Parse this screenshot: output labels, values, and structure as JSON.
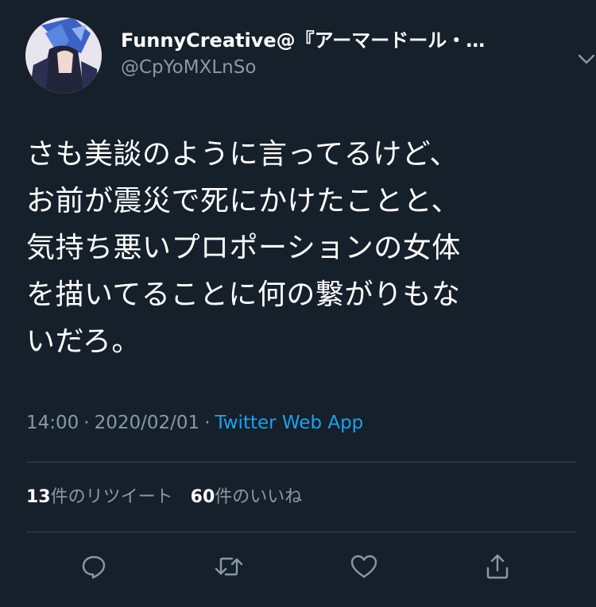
{
  "tweet": {
    "display_name": "FunnyCreative@『アーマードール・…",
    "handle": "@CpYoMXLnSo",
    "text_lines": [
      "さも美談のように言ってるけど、",
      "お前が震災で死にかけたことと、",
      "気持ち悪いプロポーションの女体",
      "を描いてることに何の繋がりもな",
      "いだろ。"
    ],
    "time": "14:00",
    "separator": "·",
    "date": "2020/02/01",
    "source": "Twitter Web App",
    "retweets_count": "13",
    "retweets_label": "件のリツイート",
    "likes_count": "60",
    "likes_label": "件のいいね"
  },
  "icons": {
    "caret": "chevron-down-icon",
    "reply": "reply-icon",
    "retweet": "retweet-icon",
    "like": "heart-icon",
    "share": "share-icon"
  },
  "colors": {
    "background": "#15202b",
    "primary_text": "#ffffff",
    "secondary_text": "#8899a6",
    "link": "#1da1f2",
    "divider": "#38444d"
  }
}
